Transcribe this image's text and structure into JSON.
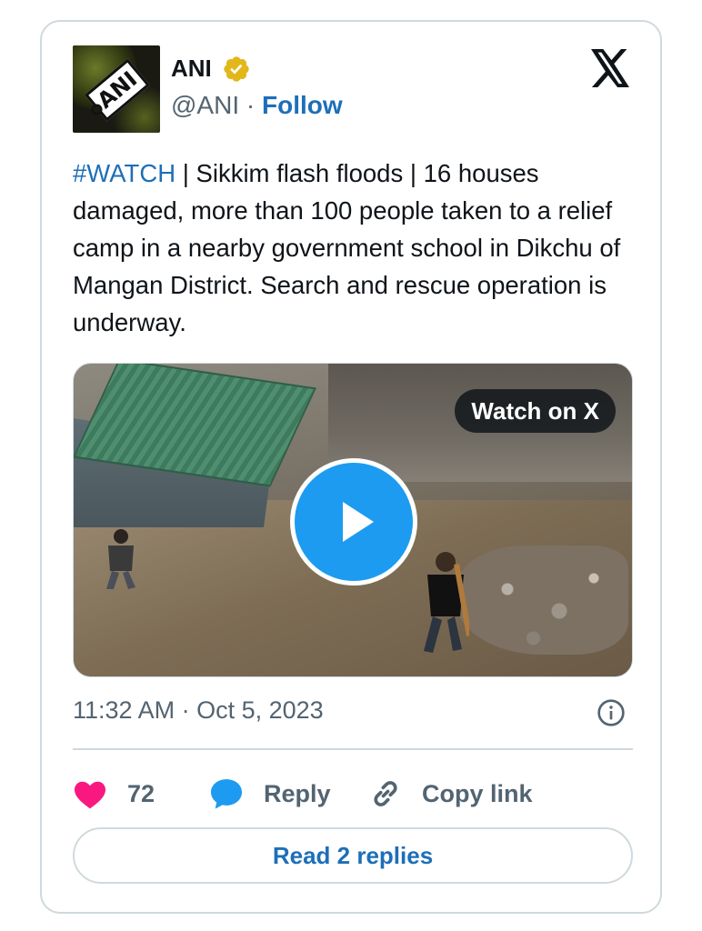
{
  "author": {
    "name": "ANI",
    "handle": "@ANI",
    "separator": "·",
    "follow_label": "Follow",
    "avatar_text": "ANI",
    "verified_icon": "verified-badge-icon"
  },
  "tweet": {
    "hashtag": "#WATCH",
    "body": " | Sikkim flash floods | 16 houses damaged, more than 100 people taken to a relief camp in a nearby government school in Dikchu of Mangan District. Search and rescue operation is underway."
  },
  "media": {
    "watch_label": "Watch on X",
    "play_icon": "play-icon"
  },
  "meta": {
    "timestamp": "11:32 AM · Oct 5, 2023",
    "info_icon": "info-icon"
  },
  "actions": {
    "like_count": "72",
    "reply_label": "Reply",
    "copy_label": "Copy link"
  },
  "read_replies_label": "Read 2 replies",
  "colors": {
    "link": "#1d6fb8",
    "like": "#f91880",
    "reply_bubble": "#1d9bf0",
    "play": "#1d9bf0",
    "border": "#cfd9de",
    "muted": "#536471"
  }
}
